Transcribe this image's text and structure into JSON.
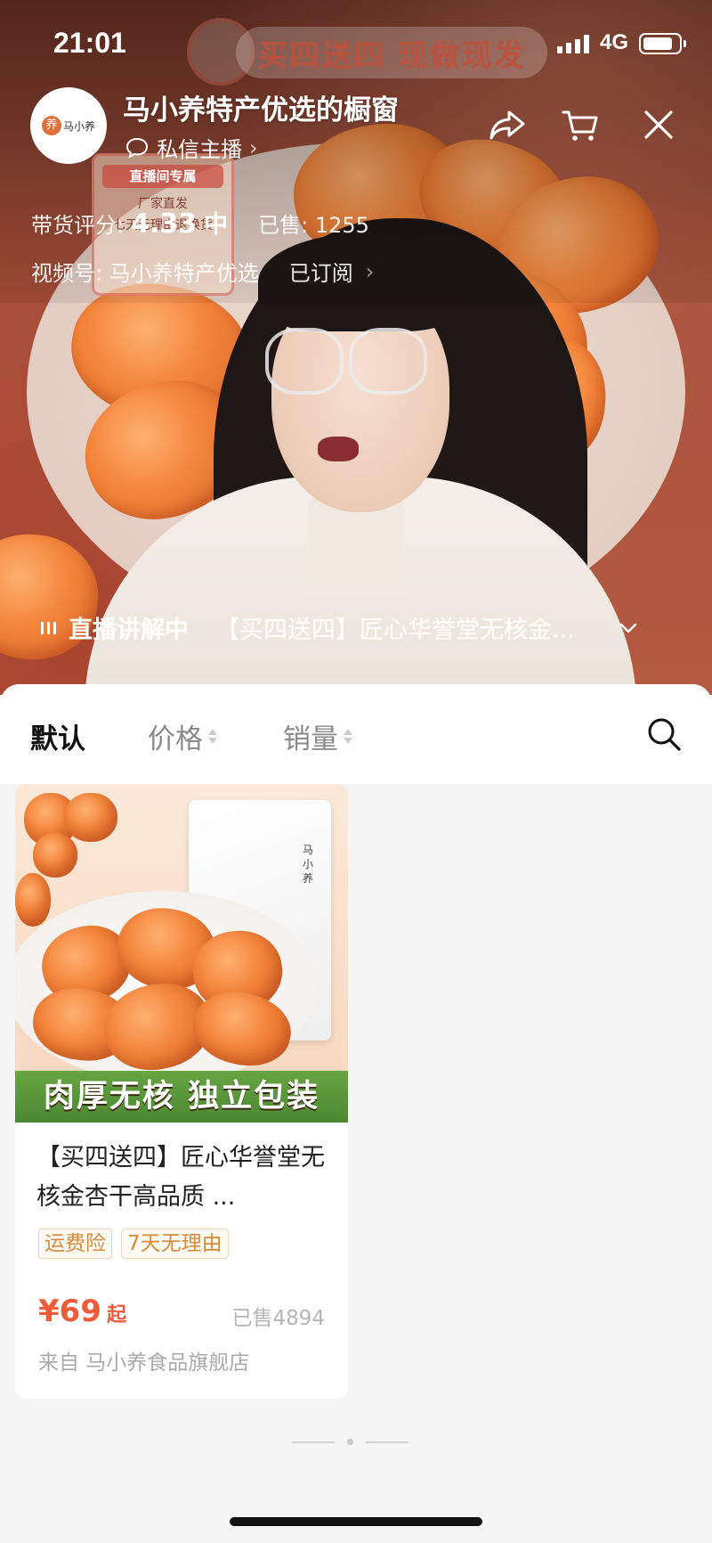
{
  "status_bar": {
    "time": "21:01",
    "network": "4G",
    "battery_level": 0.85
  },
  "promo": {
    "banner": "买四送四 现做现发",
    "card_title": "直播间专属",
    "card_line1": "厂家直发",
    "card_line2": "七天无理由退换货"
  },
  "shop": {
    "logo_seal": "养",
    "logo_name": "马小养",
    "title": "马小养特产优选的橱窗",
    "dm_label": "私信主播",
    "rating_label": "带货评分:",
    "rating_score": "4.33",
    "rating_level": "中",
    "sold_label": "已售: 1255",
    "channel_label": "视频号: 马小养特产优选",
    "subscribed_label": "已订阅"
  },
  "header_icons": [
    "share-icon",
    "cart-icon",
    "close-icon"
  ],
  "live": {
    "status_label": "直播讲解中",
    "product_title": "【买四送四】匠心华誉堂无核金..."
  },
  "sort_tabs": [
    {
      "label": "默认",
      "active": true
    },
    {
      "label": "价格",
      "active": false
    },
    {
      "label": "销量",
      "active": false
    }
  ],
  "products": [
    {
      "image_banner": "肉厚无核 独立包装",
      "pouch_brand": "马小养",
      "title": "【买四送四】匠心华誉堂无核金杏干高品质 ...",
      "tags": [
        "运费险",
        "7天无理由"
      ],
      "price": "¥69",
      "price_suffix": "起",
      "sold": "已售4894",
      "store": "来自 马小养食品旗舰店"
    }
  ],
  "colors": {
    "accent_price": "#f05b3a",
    "tag_text": "#d88a3a",
    "banner_green": "#5a9a3c"
  }
}
